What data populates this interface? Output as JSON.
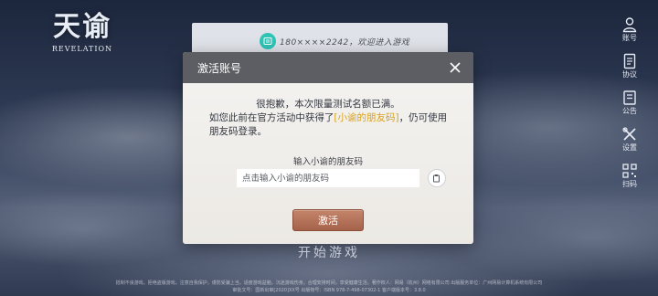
{
  "logo": {
    "cn": "天谕",
    "en": "REVELATION"
  },
  "toast": {
    "text": "180××××2242，欢迎进入游戏"
  },
  "right_menu": [
    {
      "label": "账号",
      "icon": "account-icon"
    },
    {
      "label": "协议",
      "icon": "agreement-icon"
    },
    {
      "label": "公告",
      "icon": "announcement-icon"
    },
    {
      "label": "设置",
      "icon": "settings-icon"
    },
    {
      "label": "扫码",
      "icon": "qrcode-icon"
    }
  ],
  "dialog": {
    "title": "激活账号",
    "line1": "很抱歉，本次限量测试名额已满。",
    "line2_pre": "如您此前在官方活动中获得了",
    "line2_highlight": "[小谕的朋友码]",
    "line2_post": "，仍可使用",
    "line3": "朋友码登录。",
    "input_label": "输入小谕的朋友码",
    "input_placeholder": "点击输入小谕的朋友码",
    "activate_label": "激活"
  },
  "start_game": "开始游戏",
  "footer": {
    "line1": "抵制不良游戏，拒绝盗版游戏。注意自我保护，谨防受骗上当。适度游戏益脑，沉迷游戏伤身。合理安排时间，享受健康生活。著作权人：网易（杭州）网络有限公司 出版服务单位：广州网易计算机系统有限公司",
    "line2": "审批文号：国新出审[2020]XX号 出版物号：ISBN 978-7-498-07302-1 客户端版本号：3.8.0"
  },
  "colors": {
    "highlight": "#d9a21b",
    "header": "#5c5e63",
    "activate": "#b06f55",
    "toast_icon": "#2ec4b6"
  }
}
